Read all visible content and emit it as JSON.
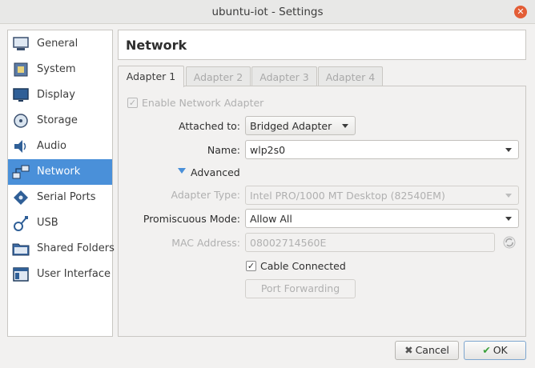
{
  "window": {
    "title": "ubuntu-iot - Settings",
    "close_icon": "close-icon"
  },
  "sidebar": {
    "items": [
      {
        "label": "General",
        "icon": "general-icon"
      },
      {
        "label": "System",
        "icon": "chip-icon"
      },
      {
        "label": "Display",
        "icon": "monitor-icon"
      },
      {
        "label": "Storage",
        "icon": "disk-icon"
      },
      {
        "label": "Audio",
        "icon": "speaker-icon"
      },
      {
        "label": "Network",
        "icon": "network-icon",
        "active": true
      },
      {
        "label": "Serial Ports",
        "icon": "serial-port-icon"
      },
      {
        "label": "USB",
        "icon": "usb-icon"
      },
      {
        "label": "Shared Folders",
        "icon": "folder-icon"
      },
      {
        "label": "User Interface",
        "icon": "window-icon"
      }
    ]
  },
  "header": {
    "title": "Network"
  },
  "tabs": [
    {
      "label": "Adapter 1",
      "active": true
    },
    {
      "label": "Adapter 2"
    },
    {
      "label": "Adapter 3"
    },
    {
      "label": "Adapter 4"
    }
  ],
  "adapter": {
    "enable_label": "Enable Network Adapter",
    "enable_checked": true,
    "attached_label": "Attached to:",
    "attached_value": "Bridged Adapter",
    "name_label": "Name:",
    "name_value": "wlp2s0",
    "advanced_label": "Advanced",
    "adapter_type_label": "Adapter Type:",
    "adapter_type_value": "Intel PRO/1000 MT Desktop (82540EM)",
    "promiscuous_label": "Promiscuous Mode:",
    "promiscuous_value": "Allow All",
    "mac_label": "MAC Address:",
    "mac_value": "08002714560E",
    "cable_label": "Cable Connected",
    "cable_checked": true,
    "port_forwarding_label": "Port Forwarding"
  },
  "footer": {
    "cancel_label": "Cancel",
    "ok_label": "OK"
  },
  "colors": {
    "accent": "#4a90d9",
    "sidebar_bg": "#ffffff",
    "window_bg": "#f2f1f0"
  }
}
